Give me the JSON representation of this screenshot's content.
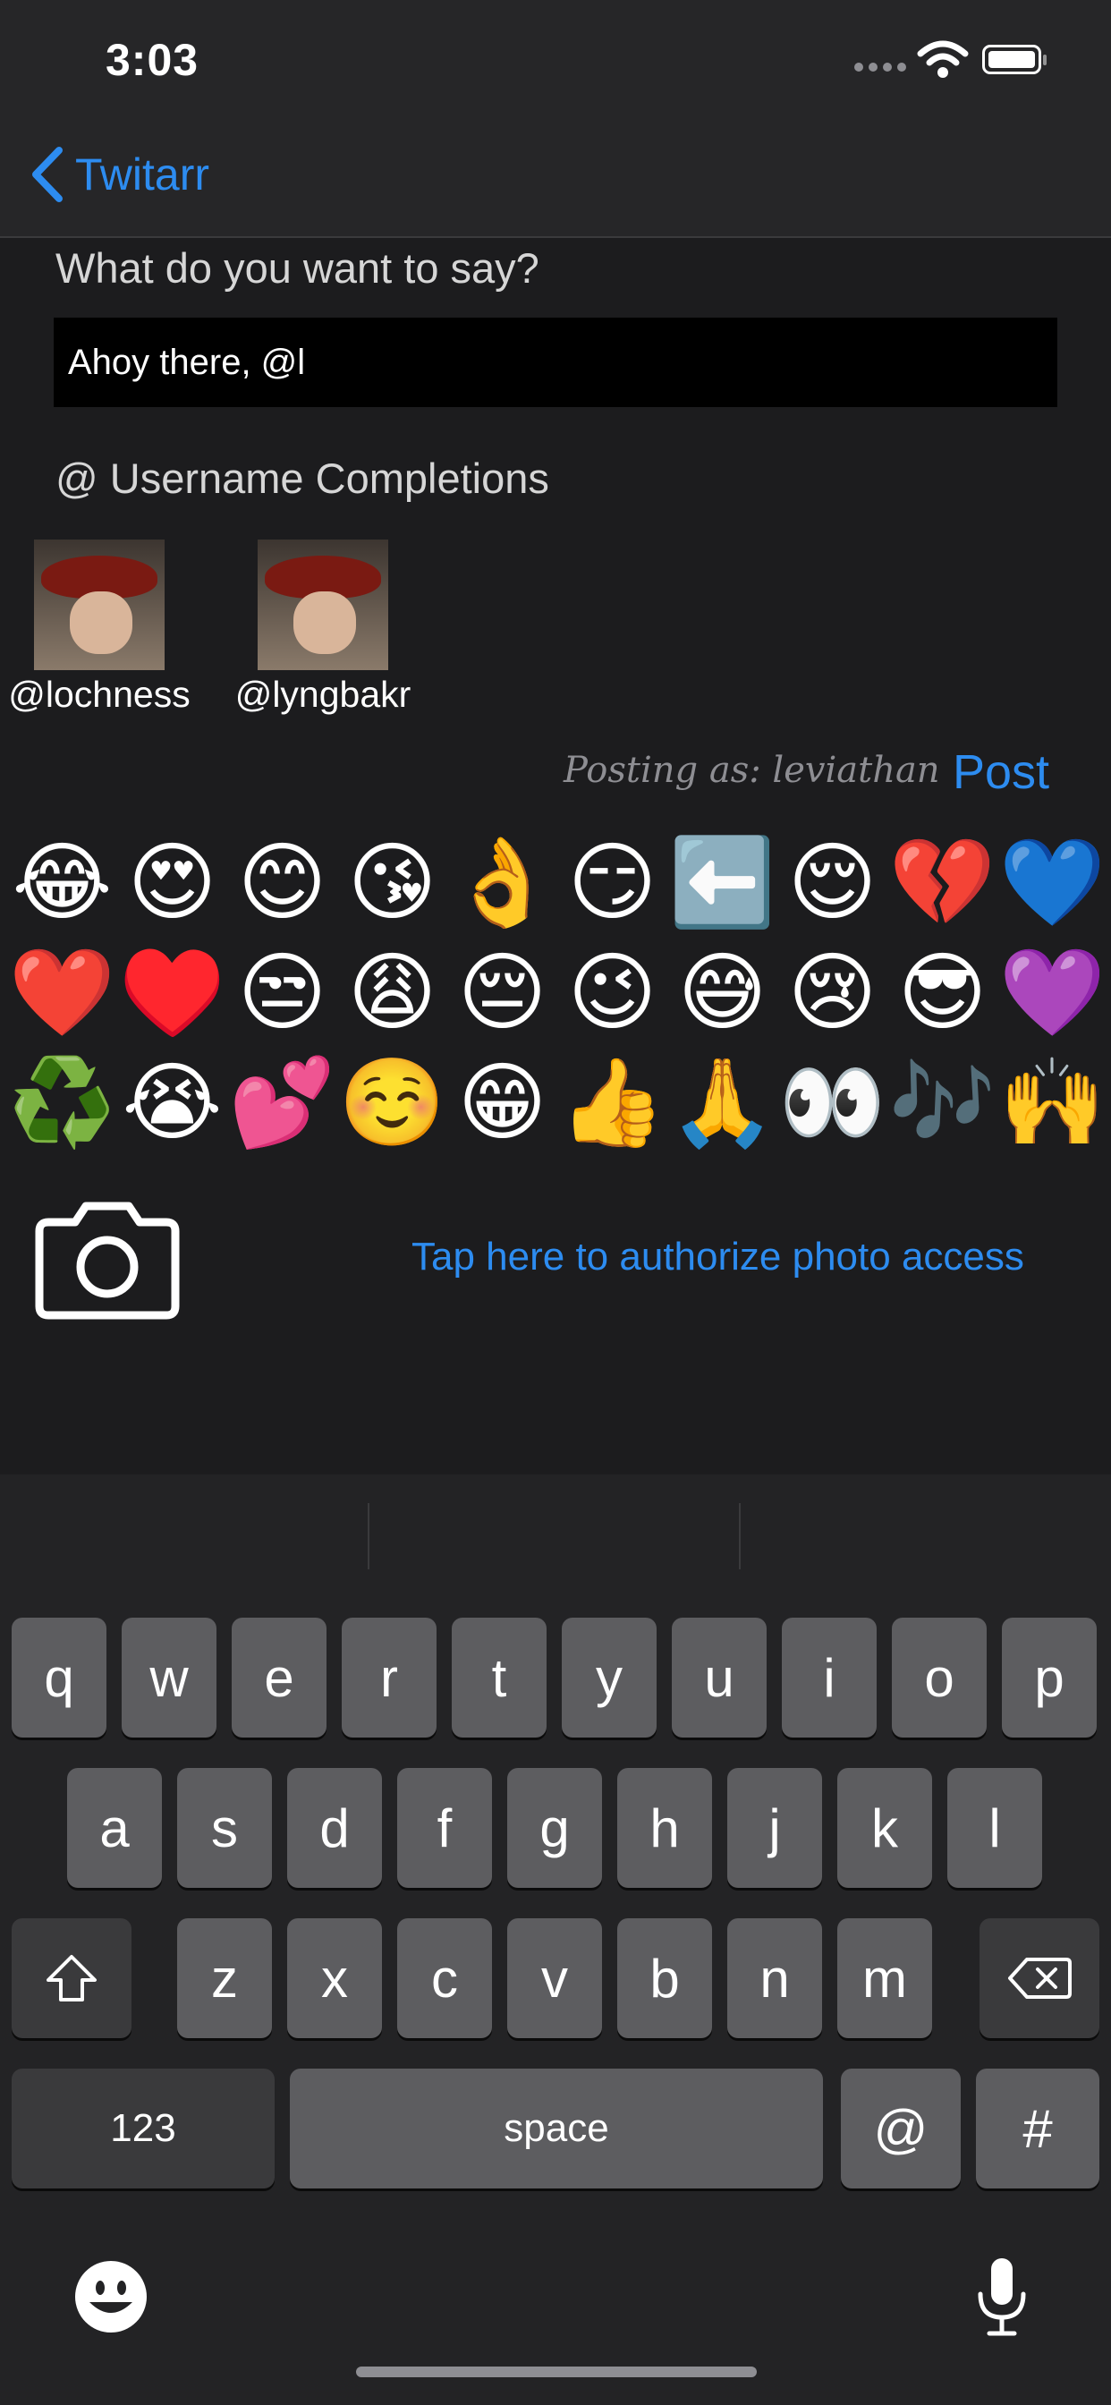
{
  "status_bar": {
    "time": "3:03"
  },
  "nav": {
    "back_label": "Twitarr"
  },
  "compose": {
    "prompt": "What do you want to say?",
    "text_value": "Ahoy there, @l"
  },
  "completions": {
    "title": "@ Username Completions",
    "users": [
      {
        "username": "@lochness"
      },
      {
        "username": "@lyngbakr"
      }
    ]
  },
  "posting": {
    "posting_as": "Posting as: leviathan",
    "post_label": "Post"
  },
  "emojis": [
    "😂",
    "😍",
    "😊",
    "😘",
    "👌",
    "😏",
    "⬅️",
    "😌",
    "💔",
    "💙",
    "❤️",
    "♥️",
    "😒",
    "😩",
    "😔",
    "😉",
    "😅",
    "😢",
    "😎",
    "💜",
    "♻️",
    "😭",
    "💕",
    "☺️",
    "😁",
    "👍",
    "🙏",
    "👀",
    "🎶",
    "🙌"
  ],
  "photo": {
    "authorize_label": "Tap here to authorize photo access"
  },
  "keyboard": {
    "row1": [
      "q",
      "w",
      "e",
      "r",
      "t",
      "y",
      "u",
      "i",
      "o",
      "p"
    ],
    "row2": [
      "a",
      "s",
      "d",
      "f",
      "g",
      "h",
      "j",
      "k",
      "l"
    ],
    "row3": [
      "z",
      "x",
      "c",
      "v",
      "b",
      "n",
      "m"
    ],
    "numbers_label": "123",
    "space_label": "space",
    "at_label": "@",
    "hash_label": "#"
  },
  "icons": {
    "back": "chevron-left-icon",
    "camera": "camera-icon",
    "emoji": "emoji-face-icon",
    "mic": "microphone-icon",
    "shift": "shift-icon",
    "delete": "delete-icon"
  },
  "colors": {
    "accent": "#2d8cf0",
    "background": "#1c1c1e",
    "text_field": "#000000"
  }
}
